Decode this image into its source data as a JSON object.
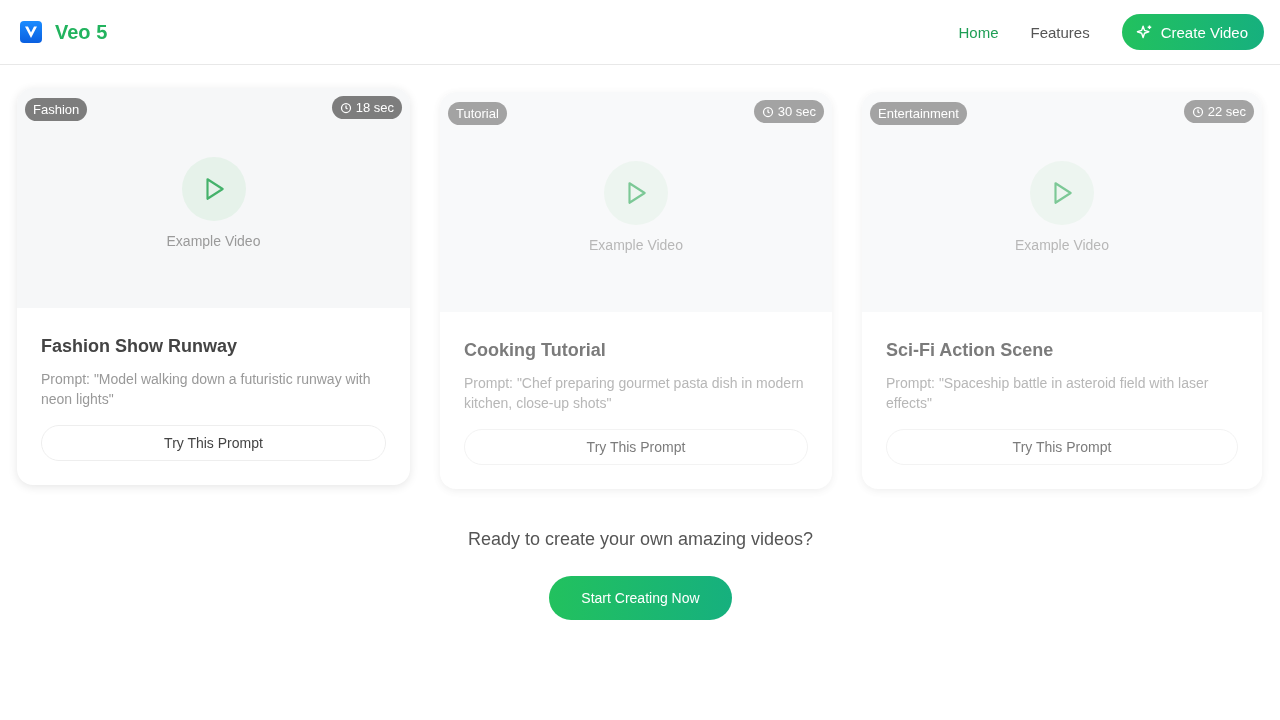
{
  "header": {
    "logo": {
      "name": "Veo 5"
    },
    "nav": [
      {
        "label": "Home",
        "selected": true
      },
      {
        "label": "Features",
        "selected": false
      }
    ],
    "cta": {
      "label": "Create Video"
    }
  },
  "cards": [
    {
      "faded": false,
      "category": "Fashion",
      "duration": "18 sec",
      "placeholder_label": "Example Video",
      "title": "Fashion Show Runway",
      "prompt": "Prompt: \"Model walking down a futuristic runway with neon lights\"",
      "button": "Try This Prompt"
    },
    {
      "faded": true,
      "category": "Tutorial",
      "duration": "30 sec",
      "placeholder_label": "Example Video",
      "title": "Cooking Tutorial",
      "prompt": "Prompt: \"Chef preparing gourmet pasta dish in modern kitchen, close-up shots\"",
      "button": "Try This Prompt"
    },
    {
      "faded": true,
      "category": "Entertainment",
      "duration": "22 sec",
      "placeholder_label": "Example Video",
      "title": "Sci-Fi Action Scene",
      "prompt": "Prompt: \"Spaceship battle in asteroid field with laser effects\"",
      "button": "Try This Prompt"
    }
  ],
  "cta_section": {
    "question": "Ready to create your own amazing videos?",
    "button": "Start Creating Now"
  }
}
